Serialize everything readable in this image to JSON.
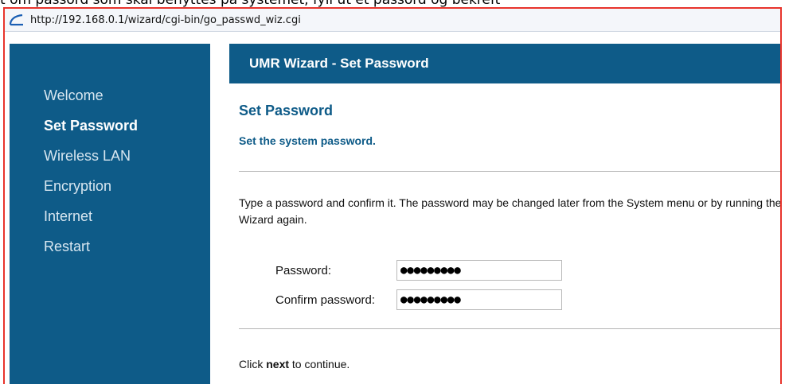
{
  "caption": "t om passord som skal benyttes på systemet, fyll ut et passord og bekreft",
  "browser": {
    "url": "http://192.168.0.1/wizard/cgi-bin/go_passwd_wiz.cgi",
    "icon": "ie-page-icon"
  },
  "sidebar": {
    "items": [
      {
        "label": "Welcome",
        "active": false
      },
      {
        "label": "Set Password",
        "active": true
      },
      {
        "label": "Wireless LAN",
        "active": false
      },
      {
        "label": "Encryption",
        "active": false
      },
      {
        "label": "Internet",
        "active": false
      },
      {
        "label": "Restart",
        "active": false
      }
    ]
  },
  "header": {
    "title": "UMR Wizard - Set Password"
  },
  "main": {
    "title": "Set Password",
    "subtitle": "Set the system password.",
    "instructions": "Type a password and confirm it. The password may be changed later from the System menu or by running the Wizard again.",
    "password_label": "Password:",
    "password_value": "●●●●●●●●●",
    "confirm_label": "Confirm password:",
    "confirm_value": "●●●●●●●●●",
    "footer_prefix": "Click ",
    "footer_bold": "next",
    "footer_suffix": " to continue."
  },
  "colors": {
    "brand": "#0e5b88",
    "frame": "#e8342c",
    "nav_text": "#d7e6f0"
  }
}
